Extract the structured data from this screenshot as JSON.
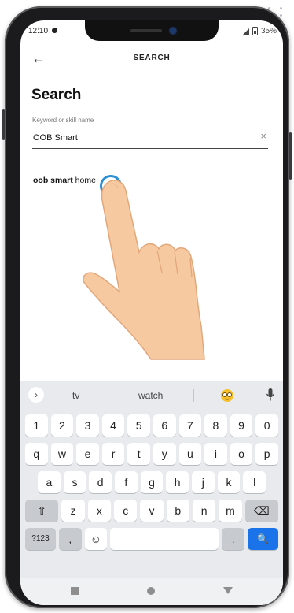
{
  "status_bar": {
    "time": "12:10",
    "battery": "35%"
  },
  "header": {
    "back_icon": "←",
    "title": "SEARCH"
  },
  "page": {
    "title": "Search"
  },
  "search_field": {
    "label": "Keyword or skill name",
    "value": "OOB Smart",
    "clear_icon": "×"
  },
  "suggestion": {
    "bold_part": "oob smart",
    "rest": " home"
  },
  "keyboard": {
    "suggestions": [
      "tv",
      "watch"
    ],
    "chevron": "›",
    "number_row": [
      "1",
      "2",
      "3",
      "4",
      "5",
      "6",
      "7",
      "8",
      "9",
      "0"
    ],
    "row1": [
      "q",
      "w",
      "e",
      "r",
      "t",
      "y",
      "u",
      "i",
      "o",
      "p"
    ],
    "row2": [
      "a",
      "s",
      "d",
      "f",
      "g",
      "h",
      "j",
      "k",
      "l"
    ],
    "row3": [
      "z",
      "x",
      "c",
      "v",
      "b",
      "n",
      "m"
    ],
    "symbols_label": "?123",
    "comma_label": ",",
    "period_label": ".",
    "shift_icon": "⇧",
    "backspace_icon": "⌫",
    "emoji_icon": "☺",
    "search_icon": "🔍"
  },
  "colors": {
    "accent_blue": "#1a73e8",
    "tap_ring": "#2c90d6",
    "keyboard_bg": "#e8eaed"
  }
}
